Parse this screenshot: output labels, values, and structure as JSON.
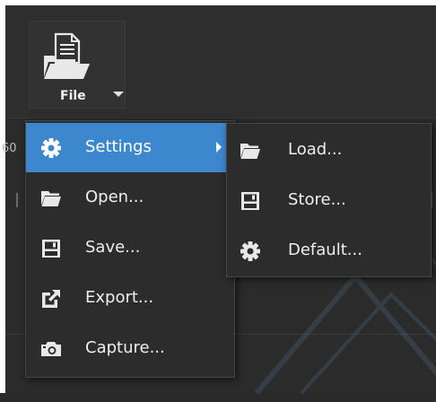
{
  "file_button": {
    "label": "File",
    "icon": "file-folder-icon",
    "dropdown_icon": "caret-down-icon"
  },
  "background": {
    "stray_text": "60"
  },
  "file_menu": {
    "items": [
      {
        "label": "Settings",
        "icon": "gear-icon",
        "highlighted": true,
        "has_submenu": true
      },
      {
        "label": "Open...",
        "icon": "folder-icon"
      },
      {
        "label": "Save...",
        "icon": "floppy-disk-icon"
      },
      {
        "label": "Export...",
        "icon": "export-icon"
      },
      {
        "label": "Capture...",
        "icon": "camera-icon"
      }
    ]
  },
  "settings_submenu": {
    "items": [
      {
        "label": "Load...",
        "icon": "folder-icon"
      },
      {
        "label": "Store...",
        "icon": "floppy-disk-icon"
      },
      {
        "label": "Default...",
        "icon": "gear-icon"
      }
    ]
  },
  "colors": {
    "menu_background": "#2c2c2c",
    "highlight": "#3d87cf",
    "text": "#eeeeee"
  }
}
